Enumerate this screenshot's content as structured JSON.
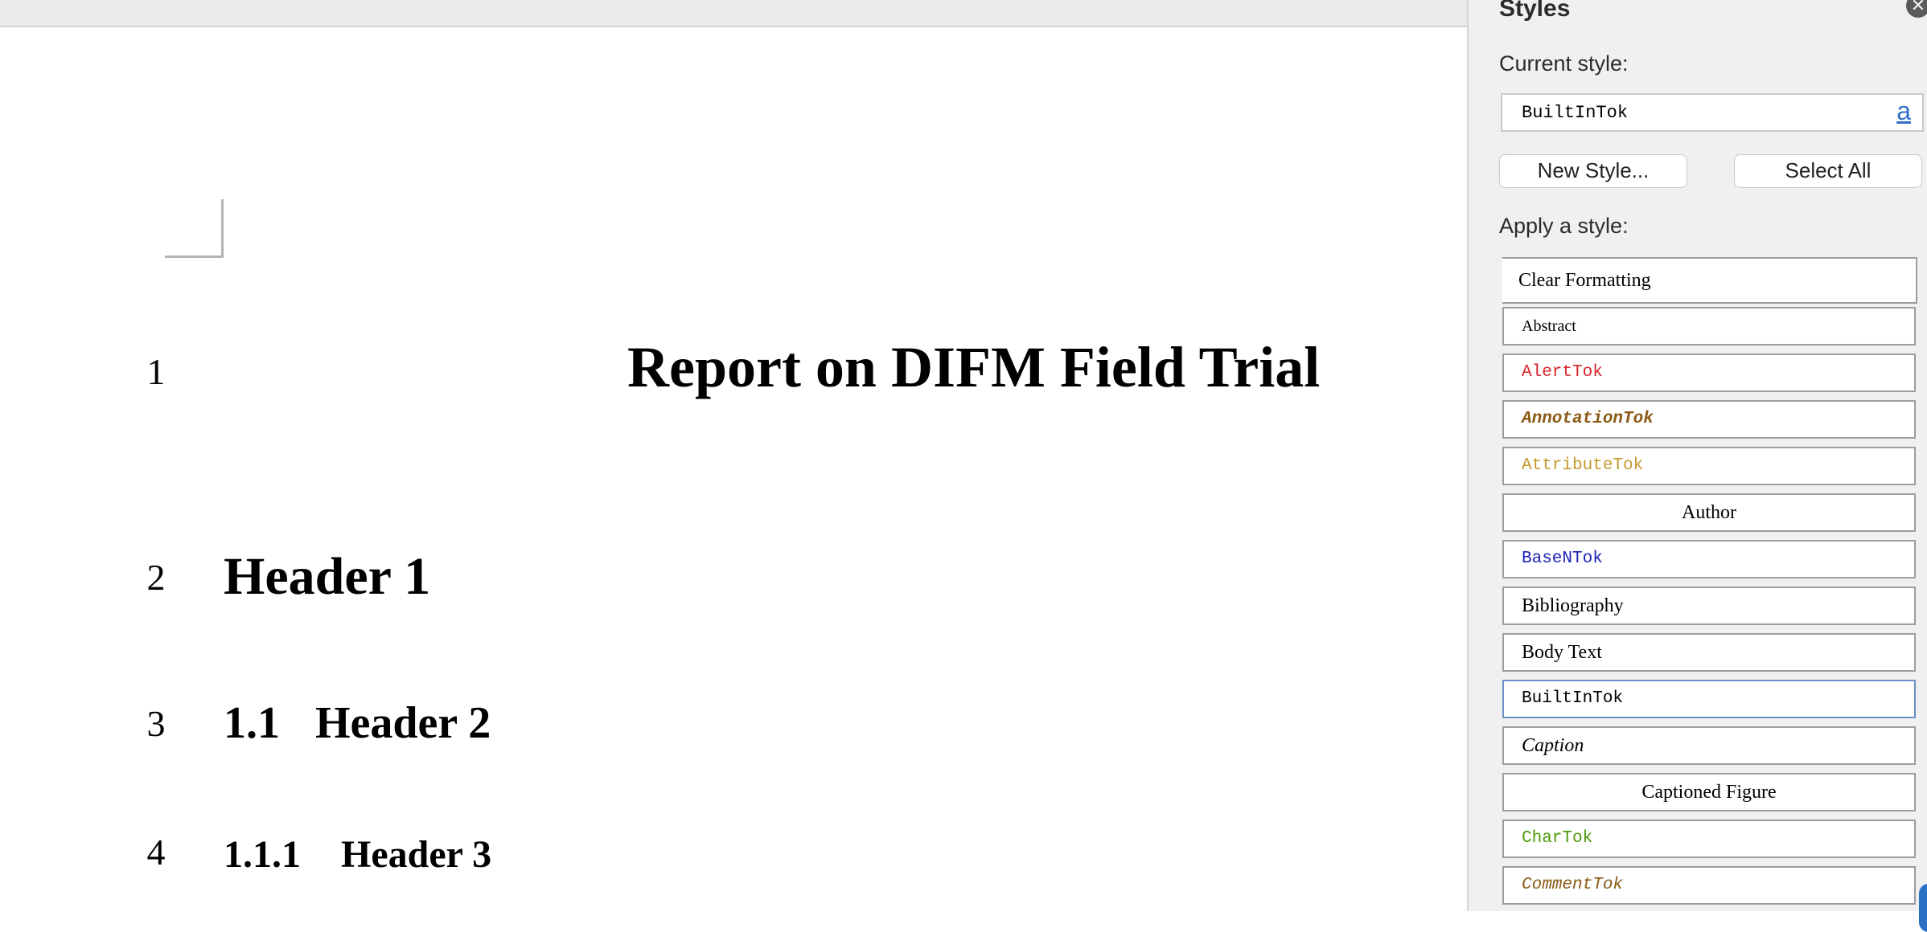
{
  "document": {
    "title": "Report on DIFM Field Trial",
    "line_numbers": [
      "1",
      "2",
      "3",
      "4"
    ],
    "headings": [
      {
        "number": "",
        "text": "Header 1"
      },
      {
        "number": "1.1",
        "text": "Header 2"
      },
      {
        "number": "1.1.1",
        "text": "Header 3"
      }
    ]
  },
  "pane": {
    "title": "Styles",
    "close_icon": "close-icon",
    "current_style_label": "Current style:",
    "current_style_value": "BuiltInTok",
    "style_preview_icon": "a",
    "new_style_label": "New Style...",
    "select_all_label": "Select All",
    "apply_label": "Apply a style:",
    "styles": [
      {
        "label": "Clear Formatting",
        "color": "#000000"
      },
      {
        "label": "Abstract",
        "color": "#000000"
      },
      {
        "label": "AlertTok",
        "color": "#d6262a"
      },
      {
        "label": "AnnotationTok",
        "color": "#8a5a14"
      },
      {
        "label": "AttributeTok",
        "color": "#c39a2c"
      },
      {
        "label": "Author",
        "color": "#000000"
      },
      {
        "label": "BaseNTok",
        "color": "#1a22b6"
      },
      {
        "label": "Bibliography",
        "color": "#000000"
      },
      {
        "label": "Body Text",
        "color": "#000000"
      },
      {
        "label": "BuiltInTok",
        "color": "#000000"
      },
      {
        "label": "Caption",
        "color": "#000000"
      },
      {
        "label": "Captioned Figure",
        "color": "#000000"
      },
      {
        "label": "CharTok",
        "color": "#4e9a06"
      },
      {
        "label": "CommentTok",
        "color": "#8a5a14"
      }
    ]
  }
}
